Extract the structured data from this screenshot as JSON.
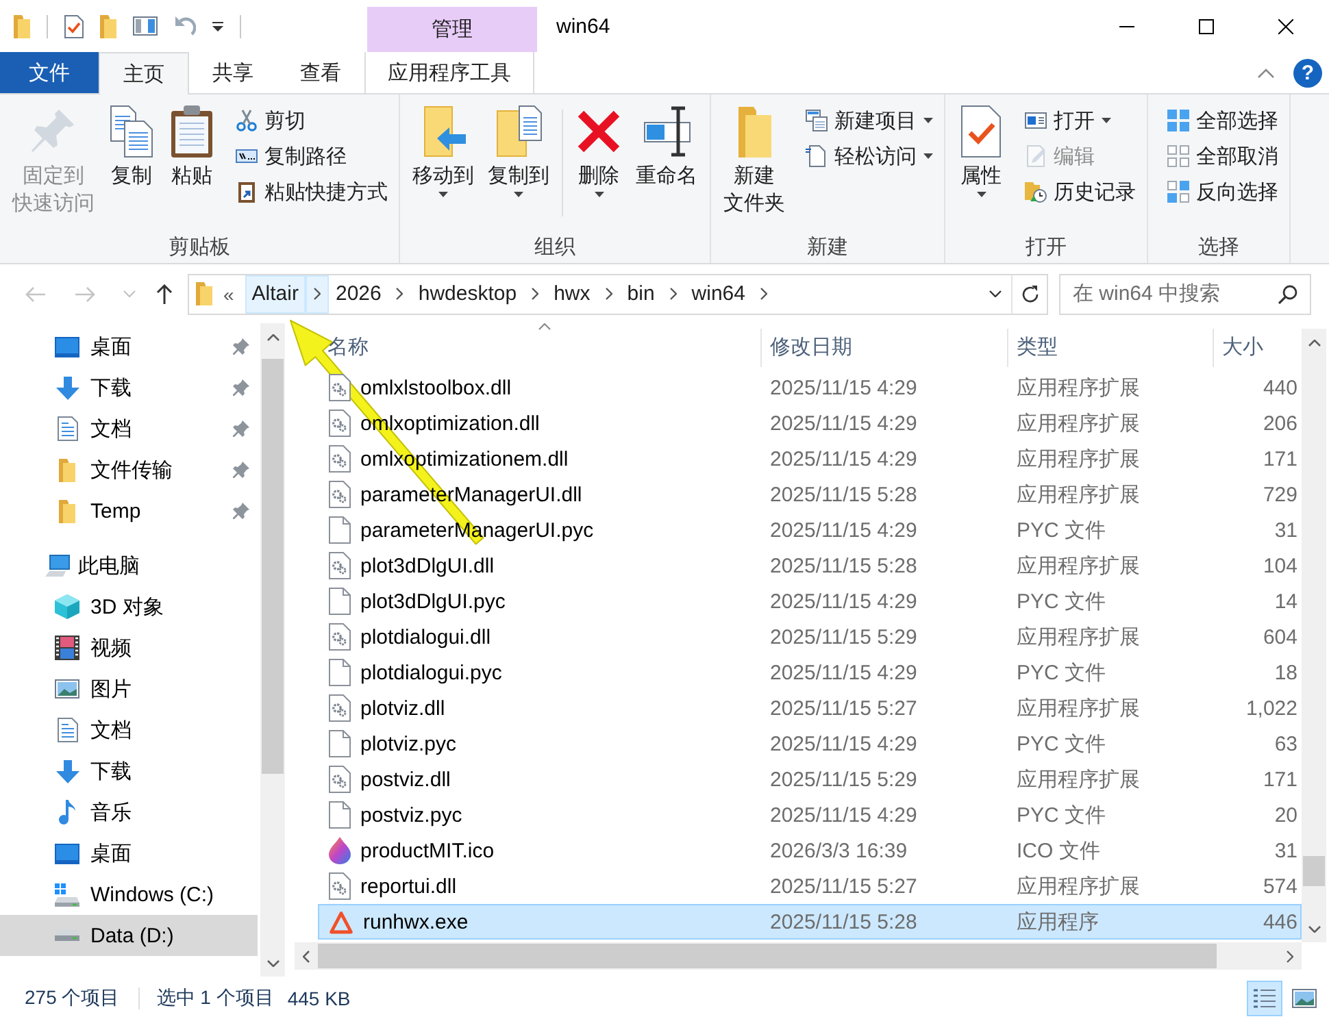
{
  "window": {
    "title": "win64",
    "contextual_header": "管理"
  },
  "ribbon_tabs": [
    {
      "label": "文件",
      "kind": "file",
      "selected": false
    },
    {
      "label": "主页",
      "kind": "standard",
      "selected": true
    },
    {
      "label": "共享",
      "kind": "standard",
      "selected": false
    },
    {
      "label": "查看",
      "kind": "standard",
      "selected": false
    },
    {
      "label": "应用程序工具",
      "kind": "contextual",
      "selected": false
    }
  ],
  "help_button": {
    "glyph": "?"
  },
  "ribbon_groups": [
    {
      "label": "剪贴板",
      "sections": [
        {
          "large_buttons": [
            {
              "label_lines": [
                "固定到",
                "快速访问"
              ],
              "kind": "pin",
              "dropdown": false,
              "disabled": true
            },
            {
              "label_lines": [
                "复制"
              ],
              "kind": "copy",
              "dropdown": false,
              "disabled": false
            },
            {
              "label_lines": [
                "粘贴"
              ],
              "kind": "paste",
              "dropdown": false,
              "disabled": false
            }
          ],
          "small_buttons": [
            {
              "label": "剪切",
              "kind": "cut",
              "dropdown": false,
              "disabled": false
            },
            {
              "label": "复制路径",
              "kind": "copypath",
              "dropdown": false,
              "disabled": false
            },
            {
              "label": "粘贴快捷方式",
              "kind": "pasteshortcut",
              "dropdown": false,
              "disabled": false
            }
          ]
        }
      ]
    },
    {
      "label": "组织",
      "sections": [
        {
          "large_buttons": [
            {
              "label_lines": [
                "移动到"
              ],
              "kind": "moveto",
              "dropdown": true,
              "disabled": false
            },
            {
              "label_lines": [
                "复制到"
              ],
              "kind": "copyto",
              "dropdown": true,
              "disabled": false
            }
          ]
        },
        {
          "large_buttons": [
            {
              "label_lines": [
                "删除"
              ],
              "kind": "delete",
              "dropdown": true,
              "disabled": false
            },
            {
              "label_lines": [
                "重命名"
              ],
              "kind": "rename",
              "dropdown": false,
              "disabled": false
            }
          ]
        }
      ]
    },
    {
      "label": "新建",
      "sections": [
        {
          "large_buttons": [
            {
              "label_lines": [
                "新建",
                "文件夹"
              ],
              "kind": "newfolder",
              "dropdown": false,
              "disabled": false
            }
          ],
          "small_buttons": [
            {
              "label": "新建项目",
              "kind": "newitem",
              "dropdown": true,
              "disabled": false
            },
            {
              "label": "轻松访问",
              "kind": "easyaccess",
              "dropdown": true,
              "disabled": false
            }
          ]
        }
      ]
    },
    {
      "label": "打开",
      "sections": [
        {
          "large_buttons": [
            {
              "label_lines": [
                "属性"
              ],
              "kind": "properties",
              "dropdown": true,
              "disabled": false
            }
          ],
          "small_buttons": [
            {
              "label": "打开",
              "kind": "open",
              "dropdown": true,
              "disabled": false
            },
            {
              "label": "编辑",
              "kind": "edit",
              "dropdown": false,
              "disabled": true
            },
            {
              "label": "历史记录",
              "kind": "history",
              "dropdown": false,
              "disabled": false
            }
          ]
        }
      ]
    },
    {
      "label": "选择",
      "sections": [
        {
          "small_buttons": [
            {
              "label": "全部选择",
              "kind": "selectall",
              "dropdown": false,
              "disabled": false
            },
            {
              "label": "全部取消",
              "kind": "selectnone",
              "dropdown": false,
              "disabled": false
            },
            {
              "label": "反向选择",
              "kind": "invert",
              "dropdown": false,
              "disabled": false
            }
          ]
        }
      ]
    }
  ],
  "address_bar": {
    "history_buttons": [
      {
        "kind": "back",
        "disabled": true
      },
      {
        "kind": "forward",
        "disabled": true
      },
      {
        "kind": "recent",
        "disabled": true
      },
      {
        "kind": "up",
        "disabled": false
      }
    ],
    "overflow": "«",
    "segments": [
      {
        "label": "Altair",
        "highlighted": true
      },
      {
        "label": "2026",
        "highlighted": false
      },
      {
        "label": "hwdesktop",
        "highlighted": false
      },
      {
        "label": "hwx",
        "highlighted": false
      },
      {
        "label": "bin",
        "highlighted": false
      },
      {
        "label": "win64",
        "highlighted": false
      }
    ]
  },
  "search": {
    "placeholder": "在 win64 中搜索"
  },
  "navigation_pane": {
    "pinned_items": [
      {
        "label": "桌面",
        "kind": "desktop",
        "pinned": true,
        "selected": false
      },
      {
        "label": "下载",
        "kind": "downloads",
        "pinned": true,
        "selected": false
      },
      {
        "label": "文档",
        "kind": "documents",
        "pinned": true,
        "selected": false
      },
      {
        "label": "文件传输",
        "kind": "folder",
        "pinned": true,
        "selected": false
      },
      {
        "label": "Temp",
        "kind": "folder",
        "pinned": true,
        "selected": false
      }
    ],
    "this_pc": {
      "label": "此电脑",
      "kind": "computer",
      "selected": false,
      "children": [
        {
          "label": "3D 对象",
          "kind": "objects",
          "selected": false
        },
        {
          "label": "视频",
          "kind": "videos",
          "selected": false
        },
        {
          "label": "图片",
          "kind": "pictures",
          "selected": false
        },
        {
          "label": "文档",
          "kind": "documents",
          "selected": false
        },
        {
          "label": "下载",
          "kind": "downloads",
          "selected": false
        },
        {
          "label": "音乐",
          "kind": "music",
          "selected": false
        },
        {
          "label": "桌面",
          "kind": "desktop",
          "selected": false
        },
        {
          "label": "Windows (C:)",
          "kind": "systemdrive",
          "selected": false
        },
        {
          "label": "Data (D:)",
          "kind": "drive",
          "selected": true
        }
      ]
    }
  },
  "file_list": {
    "columns": [
      {
        "label": "名称",
        "sorted": true
      },
      {
        "label": "修改日期",
        "sorted": false
      },
      {
        "label": "类型",
        "sorted": false
      },
      {
        "label": "大小",
        "sorted": false
      }
    ],
    "rows": [
      {
        "name": "omlxlstoolbox.dll",
        "modified": "2025/11/15 4:29",
        "type": "应用程序扩展",
        "size": "440",
        "kind": "dll",
        "selected": false
      },
      {
        "name": "omlxoptimization.dll",
        "modified": "2025/11/15 4:29",
        "type": "应用程序扩展",
        "size": "206",
        "kind": "dll",
        "selected": false
      },
      {
        "name": "omlxoptimizationem.dll",
        "modified": "2025/11/15 4:29",
        "type": "应用程序扩展",
        "size": "171",
        "kind": "dll",
        "selected": false
      },
      {
        "name": "parameterManagerUI.dll",
        "modified": "2025/11/15 5:28",
        "type": "应用程序扩展",
        "size": "729",
        "kind": "dll",
        "selected": false
      },
      {
        "name": "parameterManagerUI.pyc",
        "modified": "2025/11/15 4:29",
        "type": "PYC 文件",
        "size": "31",
        "kind": "pyc",
        "selected": false
      },
      {
        "name": "plot3dDlgUI.dll",
        "modified": "2025/11/15 5:28",
        "type": "应用程序扩展",
        "size": "104",
        "kind": "dll",
        "selected": false
      },
      {
        "name": "plot3dDlgUI.pyc",
        "modified": "2025/11/15 4:29",
        "type": "PYC 文件",
        "size": "14",
        "kind": "pyc",
        "selected": false
      },
      {
        "name": "plotdialogui.dll",
        "modified": "2025/11/15 5:29",
        "type": "应用程序扩展",
        "size": "604",
        "kind": "dll",
        "selected": false
      },
      {
        "name": "plotdialogui.pyc",
        "modified": "2025/11/15 4:29",
        "type": "PYC 文件",
        "size": "18",
        "kind": "pyc",
        "selected": false
      },
      {
        "name": "plotviz.dll",
        "modified": "2025/11/15 5:27",
        "type": "应用程序扩展",
        "size": "1,022",
        "kind": "dll",
        "selected": false
      },
      {
        "name": "plotviz.pyc",
        "modified": "2025/11/15 4:29",
        "type": "PYC 文件",
        "size": "63",
        "kind": "pyc",
        "selected": false
      },
      {
        "name": "postviz.dll",
        "modified": "2025/11/15 5:29",
        "type": "应用程序扩展",
        "size": "171",
        "kind": "dll",
        "selected": false
      },
      {
        "name": "postviz.pyc",
        "modified": "2025/11/15 4:29",
        "type": "PYC 文件",
        "size": "20",
        "kind": "pyc",
        "selected": false
      },
      {
        "name": "productMIT.ico",
        "modified": "2026/3/3 16:39",
        "type": "ICO 文件",
        "size": "31",
        "kind": "ico",
        "selected": false
      },
      {
        "name": "reportui.dll",
        "modified": "2025/11/15 5:27",
        "type": "应用程序扩展",
        "size": "574",
        "kind": "dll",
        "selected": false
      },
      {
        "name": "runhwx.exe",
        "modified": "2025/11/15 5:28",
        "type": "应用程序",
        "size": "446",
        "kind": "exe",
        "selected": true
      }
    ]
  },
  "status_bar": {
    "item_count": "275 个项目",
    "selection": "选中 1 个项目",
    "selection_size": "445 KB",
    "view_buttons": [
      {
        "kind": "details",
        "selected": true
      },
      {
        "kind": "largeicons",
        "selected": false
      }
    ]
  }
}
